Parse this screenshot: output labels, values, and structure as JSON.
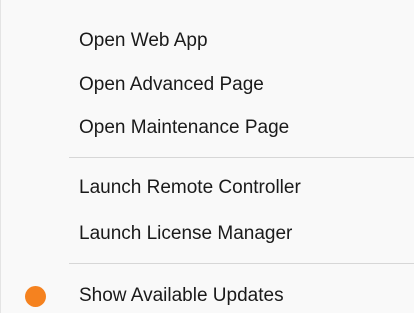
{
  "menu": {
    "items": [
      {
        "label": "Open Web App"
      },
      {
        "label": "Open Advanced Page"
      },
      {
        "label": "Open Maintenance Page"
      },
      {
        "label": "Launch Remote Controller"
      },
      {
        "label": "Launch License Manager"
      },
      {
        "label": "Show Available Updates",
        "icon": "orange-dot-icon",
        "icon_color": "#f5821f"
      }
    ]
  },
  "colors": {
    "background": "#f9f9f9",
    "text": "#1a1a1a",
    "separator": "#d7d7d7",
    "update_indicator": "#f5821f"
  }
}
